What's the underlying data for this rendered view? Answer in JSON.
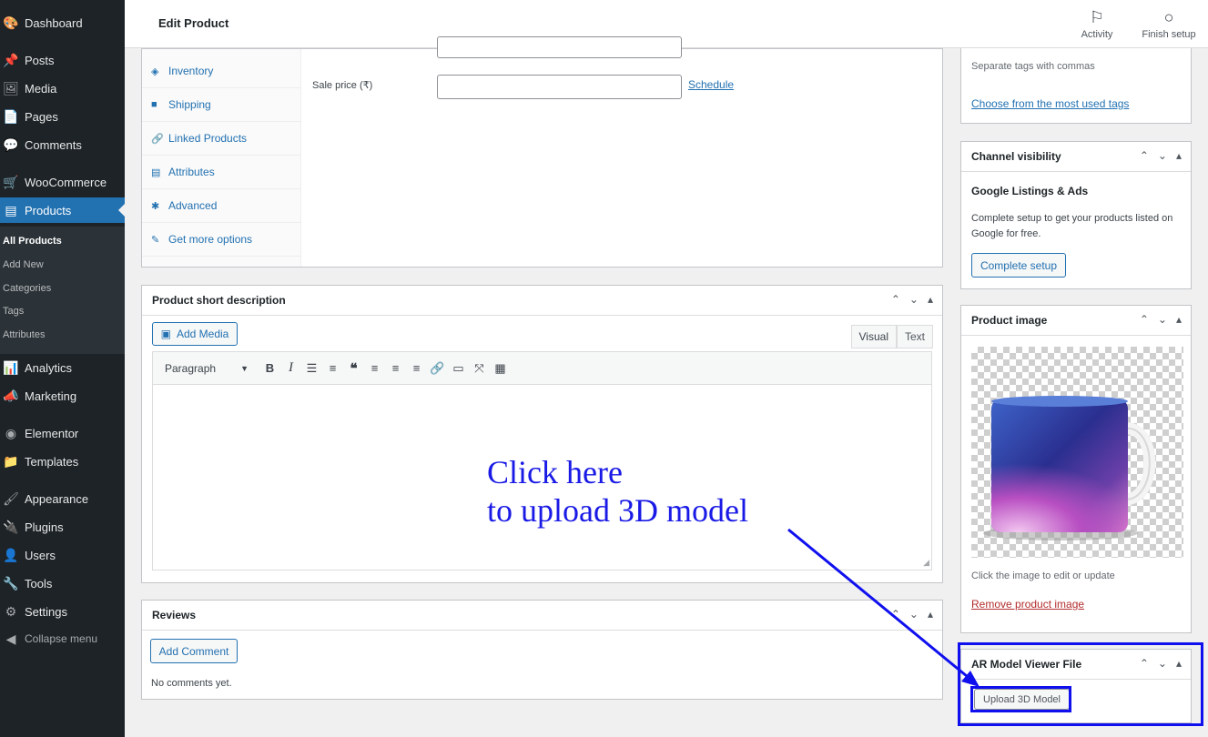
{
  "sidebar": {
    "items": [
      {
        "label": "Dashboard",
        "icon": "dashboard-icon",
        "glyph": "🎨"
      },
      {
        "label": "Posts",
        "icon": "pin-icon",
        "glyph": "📌"
      },
      {
        "label": "Media",
        "icon": "media-icon",
        "glyph": "🖼"
      },
      {
        "label": "Pages",
        "icon": "pages-icon",
        "glyph": "📄"
      },
      {
        "label": "Comments",
        "icon": "comments-icon",
        "glyph": "💬"
      },
      {
        "label": "WooCommerce",
        "icon": "woocommerce-icon",
        "glyph": "🛒"
      },
      {
        "label": "Products",
        "icon": "products-icon",
        "glyph": "▤"
      },
      {
        "label": "Analytics",
        "icon": "analytics-icon",
        "glyph": "📊"
      },
      {
        "label": "Marketing",
        "icon": "megaphone-icon",
        "glyph": "📣"
      },
      {
        "label": "Elementor",
        "icon": "elementor-icon",
        "glyph": "◉"
      },
      {
        "label": "Templates",
        "icon": "folder-icon",
        "glyph": "📁"
      },
      {
        "label": "Appearance",
        "icon": "paintbrush-icon",
        "glyph": "🖌"
      },
      {
        "label": "Plugins",
        "icon": "plugin-icon",
        "glyph": "🔌"
      },
      {
        "label": "Users",
        "icon": "users-icon",
        "glyph": "👤"
      },
      {
        "label": "Tools",
        "icon": "wrench-icon",
        "glyph": "🔧"
      },
      {
        "label": "Settings",
        "icon": "settings-icon",
        "glyph": "⚙"
      },
      {
        "label": "Collapse menu",
        "icon": "collapse-icon",
        "glyph": "◀"
      }
    ],
    "submenu": [
      "All Products",
      "Add New",
      "Categories",
      "Tags",
      "Attributes"
    ]
  },
  "header": {
    "title": "Edit Product",
    "activity_label": "Activity",
    "finish_setup_label": "Finish setup"
  },
  "product_data": {
    "tabs": [
      "Inventory",
      "Shipping",
      "Linked Products",
      "Attributes",
      "Advanced",
      "Get more options"
    ],
    "sale_price_label": "Sale price (₹)",
    "sale_price_value": "",
    "schedule_link": "Schedule"
  },
  "short_description": {
    "title": "Product short description",
    "add_media": "Add Media",
    "tab_visual": "Visual",
    "tab_text": "Text",
    "format_select": "Paragraph"
  },
  "reviews": {
    "title": "Reviews",
    "add_comment": "Add Comment",
    "empty": "No comments yet."
  },
  "tags": {
    "hint": "Separate tags with commas",
    "choose_link": "Choose from the most used tags"
  },
  "channel_visibility": {
    "title": "Channel visibility",
    "subtitle": "Google Listings & Ads",
    "description": "Complete setup to get your products listed on Google for free.",
    "button": "Complete setup"
  },
  "product_image": {
    "title": "Product image",
    "hint": "Click the image to edit or update",
    "remove_link": "Remove product image"
  },
  "ar_model": {
    "title": "AR Model Viewer File",
    "button": "Upload 3D Model"
  },
  "annotation": {
    "line1": "Click here",
    "line2": "to upload 3D model",
    "color": "#1010ee"
  },
  "colors": {
    "sidebar_bg": "#1d2327",
    "accent": "#2271b1"
  }
}
